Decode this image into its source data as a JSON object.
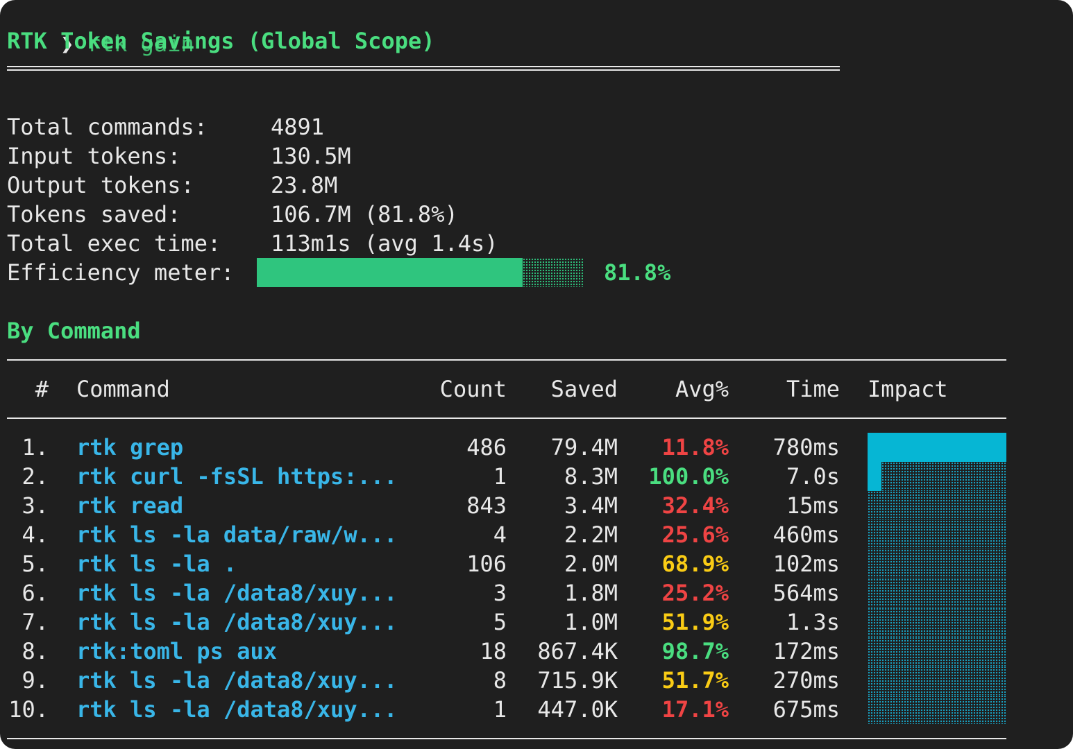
{
  "prompt": {
    "arrow": "❯",
    "command": "rtk gain"
  },
  "title": "RTK Token Savings (Global Scope)",
  "summary": [
    {
      "label": "Total commands:",
      "value": "4891"
    },
    {
      "label": "Input tokens:",
      "value": "130.5M"
    },
    {
      "label": "Output tokens:",
      "value": "23.8M"
    },
    {
      "label": "Tokens saved:",
      "value": "106.7M (81.8%)"
    },
    {
      "label": "Total exec time:",
      "value": "113m1s (avg 1.4s)"
    }
  ],
  "efficiency": {
    "label": "Efficiency meter:",
    "percent_text": "81.8%",
    "fraction": 0.818
  },
  "section_title": "By Command",
  "table": {
    "headers": {
      "num": "#",
      "command": "Command",
      "count": "Count",
      "saved": "Saved",
      "avg": "Avg%",
      "time": "Time",
      "impact": "Impact"
    },
    "rows": [
      {
        "num": "1.",
        "command": "rtk grep",
        "count": "486",
        "saved": "79.4M",
        "avg": "11.8%",
        "time": "780ms",
        "color": "red",
        "impact": 1.0
      },
      {
        "num": "2.",
        "command": "rtk curl -fsSL https:...",
        "count": "1",
        "saved": "8.3M",
        "avg": "100.0%",
        "time": "7.0s",
        "color": "green",
        "impact": 0.1
      },
      {
        "num": "3.",
        "command": "rtk read",
        "count": "843",
        "saved": "3.4M",
        "avg": "32.4%",
        "time": "15ms",
        "color": "red",
        "impact": 0
      },
      {
        "num": "4.",
        "command": "rtk ls -la data/raw/w...",
        "count": "4",
        "saved": "2.2M",
        "avg": "25.6%",
        "time": "460ms",
        "color": "red",
        "impact": 0
      },
      {
        "num": "5.",
        "command": "rtk ls -la .",
        "count": "106",
        "saved": "2.0M",
        "avg": "68.9%",
        "time": "102ms",
        "color": "yellow",
        "impact": 0
      },
      {
        "num": "6.",
        "command": "rtk ls -la /data8/xuy...",
        "count": "3",
        "saved": "1.8M",
        "avg": "25.2%",
        "time": "564ms",
        "color": "red",
        "impact": 0
      },
      {
        "num": "7.",
        "command": "rtk ls -la /data8/xuy...",
        "count": "5",
        "saved": "1.0M",
        "avg": "51.9%",
        "time": "1.3s",
        "color": "yellow",
        "impact": 0
      },
      {
        "num": "8.",
        "command": "rtk:toml ps aux",
        "count": "18",
        "saved": "867.4K",
        "avg": "98.7%",
        "time": "172ms",
        "color": "green",
        "impact": 0
      },
      {
        "num": "9.",
        "command": "rtk ls -la /data8/xuy...",
        "count": "8",
        "saved": "715.9K",
        "avg": "51.7%",
        "time": "270ms",
        "color": "yellow",
        "impact": 0
      },
      {
        "num": "10.",
        "command": "rtk ls -la /data8/xuy...",
        "count": "1",
        "saved": "447.0K",
        "avg": "17.1%",
        "time": "675ms",
        "color": "red",
        "impact": 0
      }
    ]
  },
  "colors": {
    "background": "#1f1f1f",
    "green": "#4ade80",
    "cyan": "#06b6d4",
    "command_blue": "#39b6e8",
    "red": "#ef4444",
    "yellow": "#facc15"
  }
}
